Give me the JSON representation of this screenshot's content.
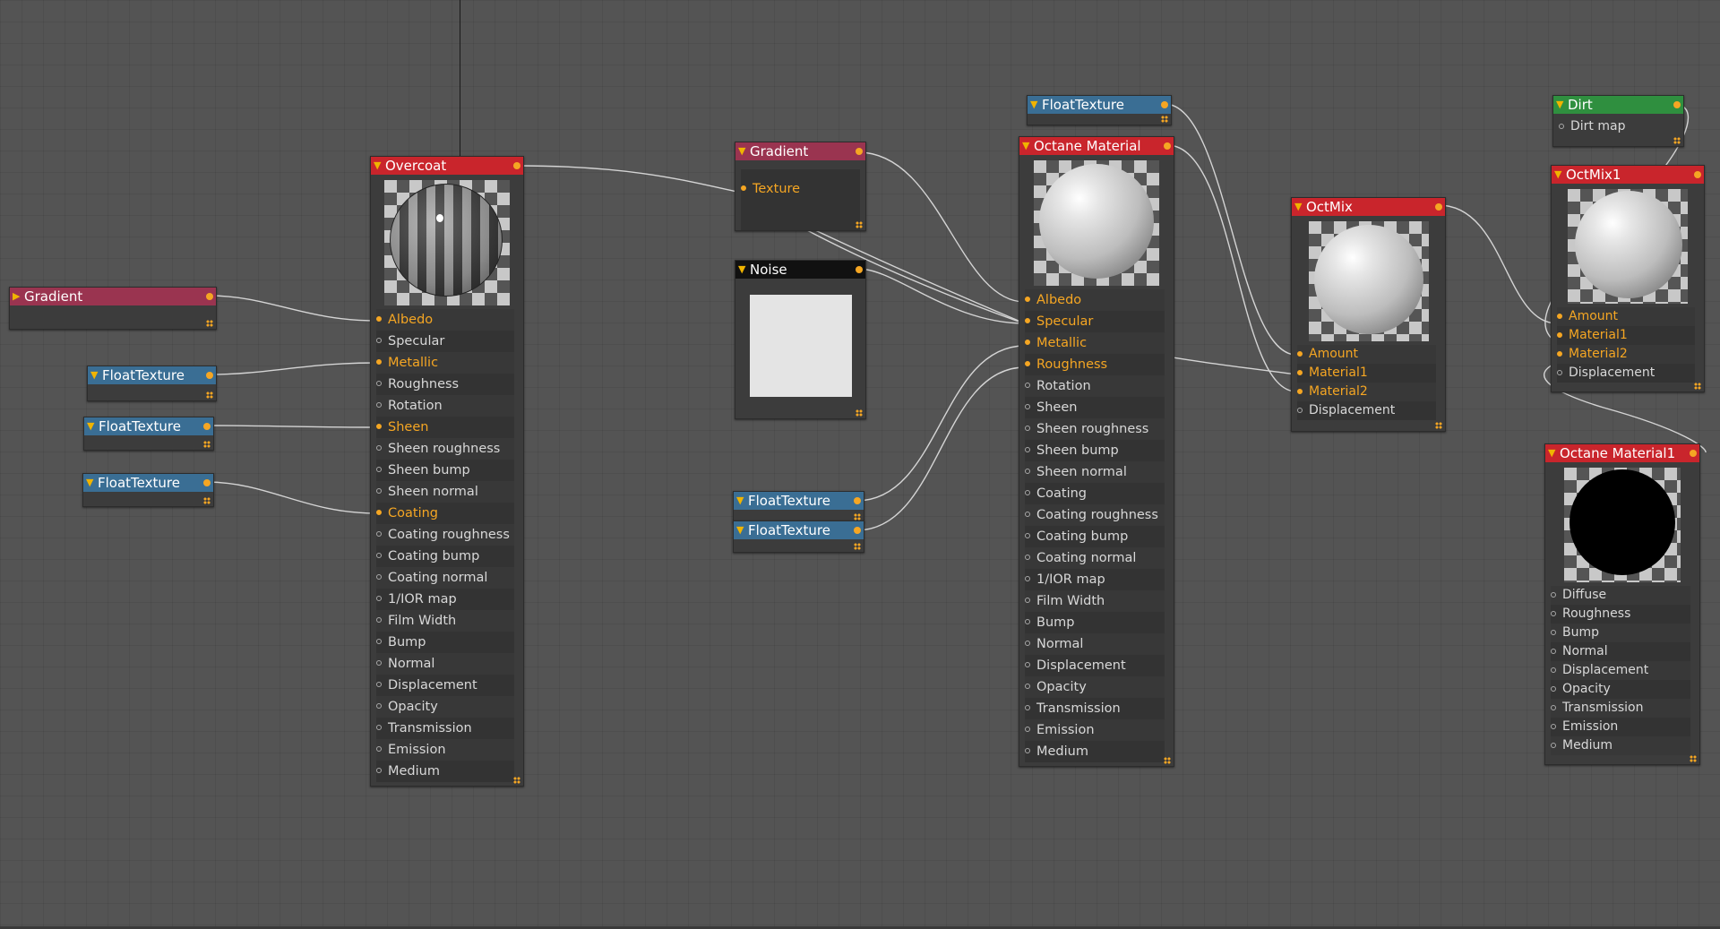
{
  "nodes": {
    "overcoat": {
      "title": "Overcoat",
      "pins": [
        "Albedo",
        "Specular",
        "Metallic",
        "Roughness",
        "Rotation",
        "Sheen",
        "Sheen roughness",
        "Sheen bump",
        "Sheen normal",
        "Coating",
        "Coating roughness",
        "Coating bump",
        "Coating normal",
        "1/IOR map",
        "Film Width",
        "Bump",
        "Normal",
        "Displacement",
        "Opacity",
        "Transmission",
        "Emission",
        "Medium"
      ],
      "connected": [
        0,
        2,
        5,
        9
      ]
    },
    "gradient_left": {
      "title": "Gradient"
    },
    "floattex_1": {
      "title": "FloatTexture"
    },
    "floattex_2": {
      "title": "FloatTexture"
    },
    "floattex_3": {
      "title": "FloatTexture"
    },
    "gradient_mid": {
      "title": "Gradient",
      "pin": "Texture"
    },
    "noise": {
      "title": "Noise"
    },
    "floattex_4": {
      "title": "FloatTexture"
    },
    "floattex_5": {
      "title": "FloatTexture"
    },
    "floattex_top": {
      "title": "FloatTexture"
    },
    "octane_material": {
      "title": "Octane Material",
      "pins": [
        "Albedo",
        "Specular",
        "Metallic",
        "Roughness",
        "Rotation",
        "Sheen",
        "Sheen roughness",
        "Sheen bump",
        "Sheen normal",
        "Coating",
        "Coating roughness",
        "Coating bump",
        "Coating normal",
        "1/IOR map",
        "Film Width",
        "Bump",
        "Normal",
        "Displacement",
        "Opacity",
        "Transmission",
        "Emission",
        "Medium"
      ],
      "connected": [
        0,
        1,
        2,
        3
      ]
    },
    "octmix": {
      "title": "OctMix",
      "pins": [
        "Amount",
        "Material1",
        "Material2",
        "Displacement"
      ],
      "connected": [
        0,
        1,
        2
      ]
    },
    "dirt": {
      "title": "Dirt",
      "pin": "Dirt map"
    },
    "octmix1": {
      "title": "OctMix1",
      "pins": [
        "Amount",
        "Material1",
        "Material2",
        "Displacement"
      ],
      "connected": [
        0,
        1,
        2
      ]
    },
    "octane_material1": {
      "title": "Octane Material1",
      "pins": [
        "Diffuse",
        "Roughness",
        "Bump",
        "Normal",
        "Displacement",
        "Opacity",
        "Transmission",
        "Emission",
        "Medium"
      ],
      "connected": []
    }
  },
  "colors": {
    "material_header": "#c9252c",
    "texture_header": "#9a3450",
    "float_header": "#3a6e94",
    "dirt_header": "#2f8f3f",
    "noise_header": "#111111",
    "connected_pin": "#f5a623",
    "canvas": "#545454"
  }
}
